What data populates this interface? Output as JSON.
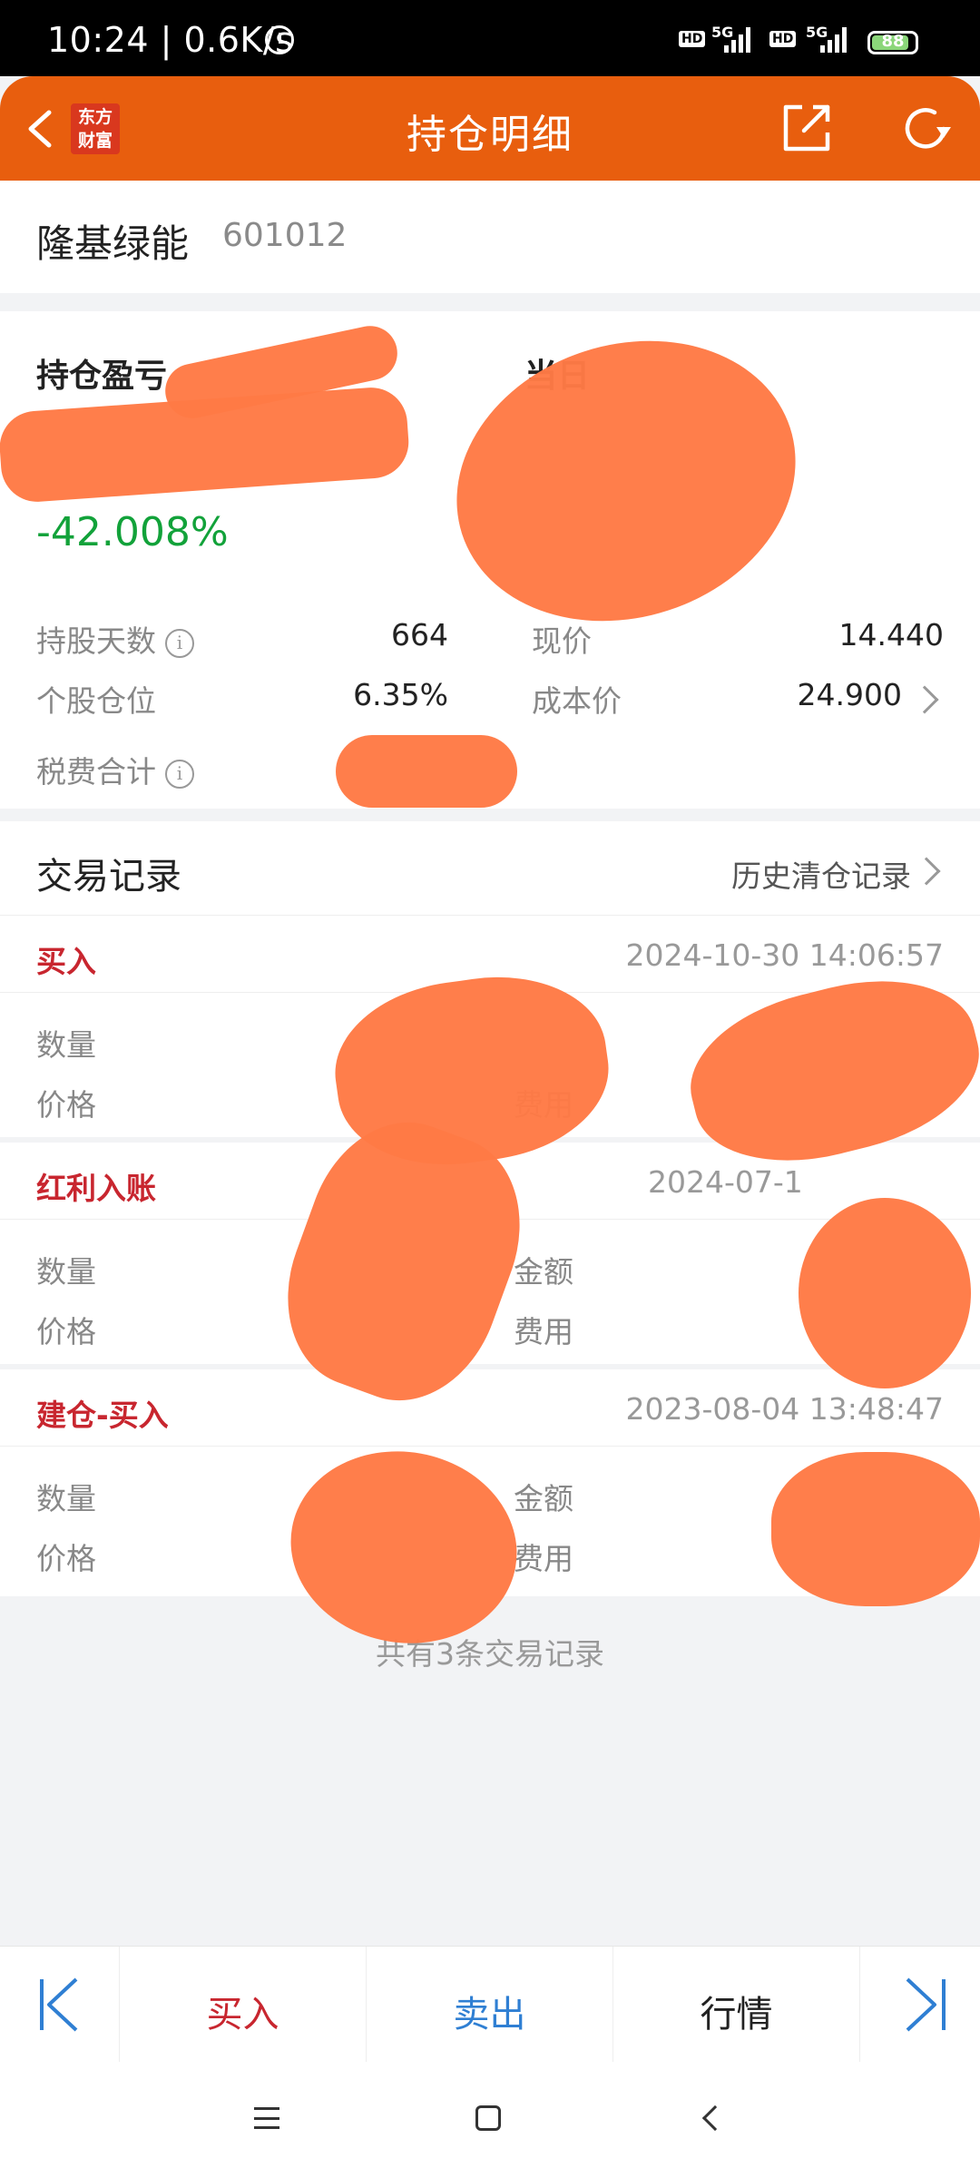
{
  "status": {
    "time": "10:24 | 0.6K/s",
    "battery": "88",
    "net1": "5G",
    "net2": "5G",
    "hd": "HD"
  },
  "header": {
    "title": "持仓明细",
    "logo_line1": "东方",
    "logo_line2": "财富"
  },
  "stock": {
    "name": "隆基绿能",
    "code": "601012"
  },
  "summary": {
    "pl_label": "持仓盈亏",
    "day_label": "当日",
    "pl_pct": "-42.008%",
    "hold_days_label": "持股天数",
    "hold_days": "664",
    "position_label": "个股仓位",
    "position": "6.35%",
    "fee_label": "税费合计",
    "price_label": "现价",
    "price": "14.440",
    "cost_label": "成本价",
    "cost": "24.900"
  },
  "records": {
    "title": "交易记录",
    "history_link": "历史清仓记录",
    "items": [
      {
        "type": "买入",
        "time": "2024-10-30 14:06:57",
        "qty_label": "数量",
        "price_label": "价格",
        "amount_label": "",
        "fee_label": "费用"
      },
      {
        "type": "红利入账",
        "time": "2024-07-1",
        "qty_label": "数量",
        "price_label": "价格",
        "amount_label": "金额",
        "fee_label": "费用"
      },
      {
        "type": "建仓-买入",
        "time": "2023-08-04 13:48:47",
        "qty_label": "数量",
        "price_label": "价格",
        "amount_label": "金额",
        "fee_label": "费用"
      }
    ],
    "footer": "共有3条交易记录"
  },
  "actions": {
    "buy": "买入",
    "sell": "卖出",
    "quote": "行情"
  },
  "colors": {
    "header": "#e85e0e",
    "loss": "#12a23a",
    "buy": "#c8262f",
    "sell": "#2f7fd3",
    "scribble": "#ff7a45"
  }
}
